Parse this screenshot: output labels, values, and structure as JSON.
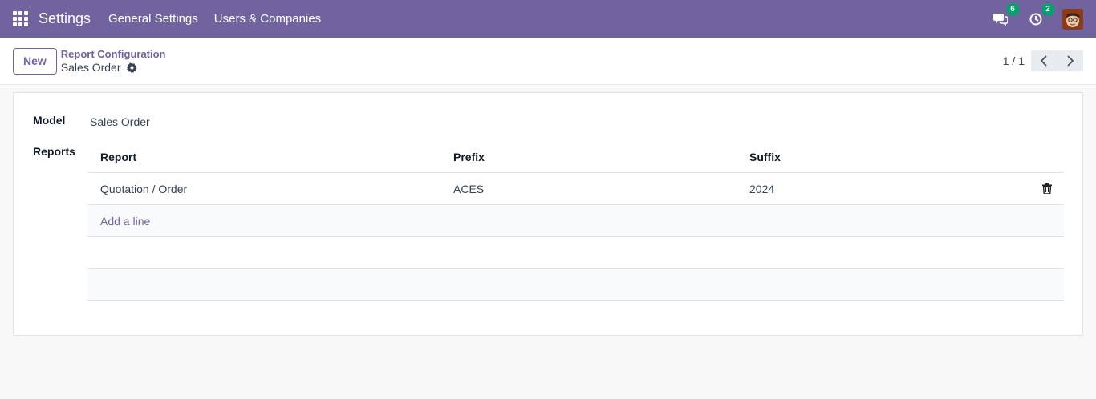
{
  "navbar": {
    "app_name": "Settings",
    "menu": [
      "General Settings",
      "Users & Companies"
    ],
    "messages_count": "6",
    "activities_count": "2"
  },
  "control": {
    "new_label": "New",
    "breadcrumb_parent": "Report Configuration",
    "breadcrumb_current": "Sales Order",
    "pager": "1 / 1"
  },
  "form": {
    "model_label": "Model",
    "model_value": "Sales Order",
    "reports_label": "Reports",
    "columns": [
      "Report",
      "Prefix",
      "Suffix"
    ],
    "rows": [
      {
        "report": "Quotation / Order",
        "prefix": "ACES",
        "suffix": "2024"
      }
    ],
    "add_line": "Add a line"
  },
  "colors": {
    "brand": "#71639e",
    "badge": "#00a36c"
  },
  "icons": [
    "apps-grid-icon",
    "chat-icon",
    "clock-icon",
    "gear-icon",
    "chevron-left-icon",
    "chevron-right-icon",
    "trash-icon"
  ]
}
